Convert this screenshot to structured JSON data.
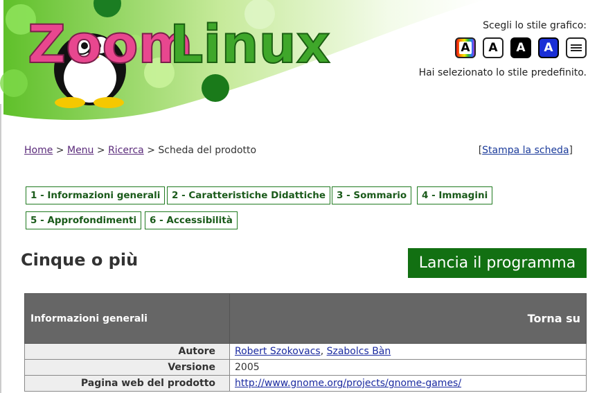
{
  "header": {
    "logo_text": "ZoomLinux",
    "style_picker": {
      "label": "Scegli lo stile grafico:",
      "buttons": [
        {
          "name": "color",
          "glyph": "A"
        },
        {
          "name": "white",
          "glyph": "A"
        },
        {
          "name": "black",
          "glyph": "A"
        },
        {
          "name": "blue",
          "glyph": "A"
        },
        {
          "name": "text-only",
          "icon": "lines-icon"
        }
      ],
      "status": "Hai selezionato lo stile predefinito."
    }
  },
  "breadcrumb": {
    "items": [
      "Home",
      "Menu",
      "Ricerca"
    ],
    "current": "Scheda del prodotto",
    "separator": ">"
  },
  "print": {
    "label": "Stampa la scheda"
  },
  "tabs": [
    "1 - Informazioni generali",
    "2 - Caratteristiche Didattiche",
    "3 - Sommario",
    "4 - Immagini",
    "5 - Approfondimenti",
    "6 - Accessibilità"
  ],
  "page_title": "Cinque o più",
  "launch_button": "Lancia il programma",
  "info": {
    "section_title": "Informazioni generali",
    "back_to_top": "Torna su",
    "rows": [
      {
        "key": "Autore",
        "links": [
          "Robert Szokovacs",
          "Szabolcs Bàn"
        ],
        "sep": ", "
      },
      {
        "key": "Versione",
        "value": "2005"
      },
      {
        "key": "Pagina web del prodotto",
        "links": [
          "http://www.gnome.org/projects/gnome-games/"
        ]
      }
    ]
  },
  "colors": {
    "accent_green": "#127012",
    "tab_border": "#1f7a1f",
    "table_header": "#666666"
  }
}
